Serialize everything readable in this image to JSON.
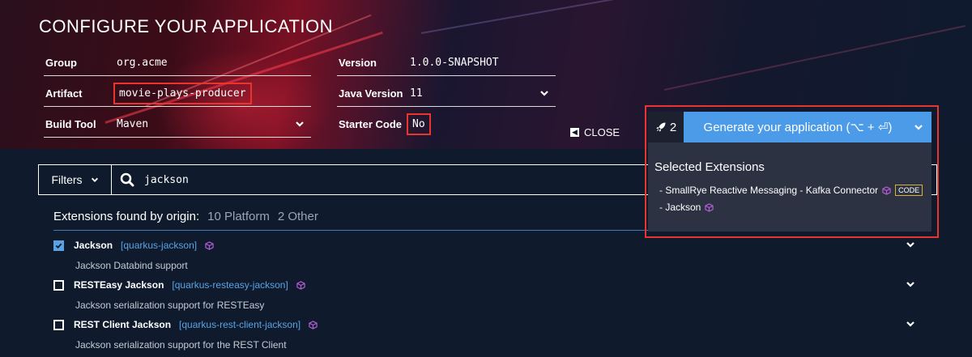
{
  "page_title": "CONFIGURE YOUR APPLICATION",
  "fields": {
    "group": {
      "label": "Group",
      "value": "org.acme"
    },
    "version": {
      "label": "Version",
      "value": "1.0.0-SNAPSHOT"
    },
    "artifact": {
      "label": "Artifact",
      "value": "movie-plays-producer"
    },
    "java_version": {
      "label": "Java Version",
      "value": "11"
    },
    "build_tool": {
      "label": "Build Tool",
      "value": "Maven"
    },
    "starter_code": {
      "label": "Starter Code",
      "value": "No"
    }
  },
  "close_label": "CLOSE",
  "filters_label": "Filters",
  "search_value": "jackson",
  "extensions_header": {
    "title": "Extensions found by origin:",
    "platform": "10 Platform",
    "other": "2 Other"
  },
  "extensions": [
    {
      "name": "Jackson",
      "id": "[quarkus-jackson]",
      "description": "Jackson Databind support",
      "checked": true
    },
    {
      "name": "RESTEasy Jackson",
      "id": "[quarkus-resteasy-jackson]",
      "description": "Jackson serialization support for RESTEasy",
      "checked": false
    },
    {
      "name": "REST Client Jackson",
      "id": "[quarkus-rest-client-jackson]",
      "description": "Jackson serialization support for the REST Client",
      "checked": false
    }
  ],
  "generate": {
    "count": "2",
    "label": "Generate your application (⌥ + ⏎)"
  },
  "selected": {
    "title": "Selected Extensions",
    "items": [
      {
        "label": "- SmallRye Reactive Messaging - Kafka Connector",
        "tag": "CODE"
      },
      {
        "label": "- Jackson"
      }
    ]
  },
  "colors": {
    "accent_blue": "#4b9be8",
    "highlight_red": "#e8362e",
    "platform_purple": "#b35cd6",
    "code_tag_gold": "#d4b23a"
  }
}
